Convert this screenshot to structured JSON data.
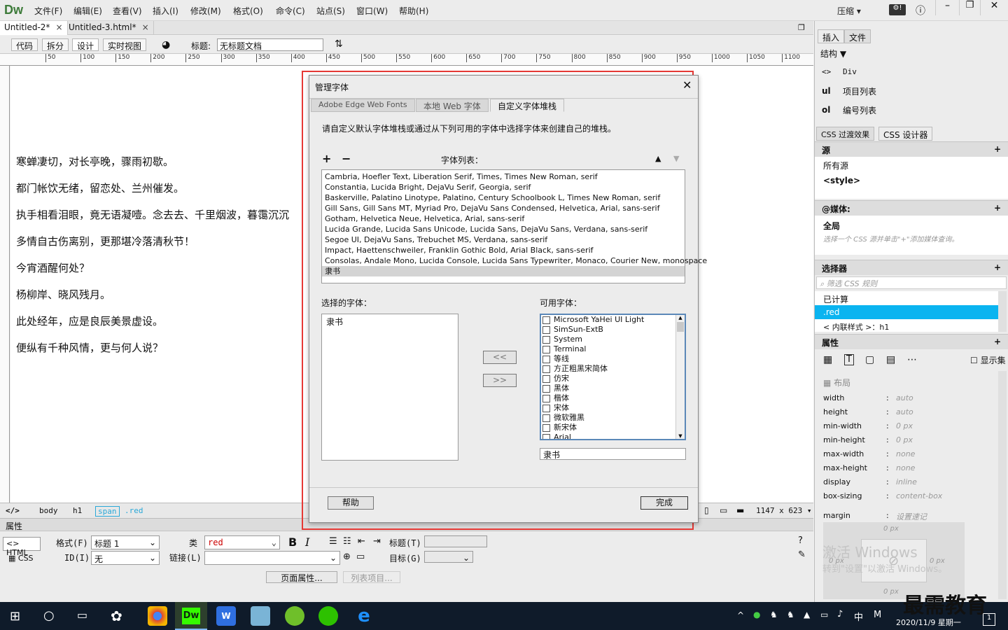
{
  "app": {
    "logo": "Dw",
    "compress_label": "压缩"
  },
  "menu": [
    "文件(F)",
    "编辑(E)",
    "查看(V)",
    "插入(I)",
    "修改(M)",
    "格式(O)",
    "命令(C)",
    "站点(S)",
    "窗口(W)",
    "帮助(H)"
  ],
  "doc_tabs": [
    {
      "label": "Untitled-2*"
    },
    {
      "label": "Untitled-3.html*"
    }
  ],
  "view_buttons": {
    "code": "代码",
    "split": "拆分",
    "design": "设计",
    "live": "实时视图"
  },
  "title_field": {
    "label": "标题:",
    "value": "无标题文档"
  },
  "ruler_ticks": [
    "50",
    "100",
    "150",
    "200",
    "250",
    "300",
    "350",
    "400",
    "450",
    "500",
    "550",
    "600",
    "650",
    "700",
    "750",
    "800",
    "850",
    "900",
    "950",
    "1000",
    "1050",
    "1100"
  ],
  "poem": [
    "寒蝉凄切，对长亭晚，骤雨初歇。",
    "都门帐饮无绪，留恋处、兰州催发。",
    "执手相看泪眼，竟无语凝噎。念去去、千里烟波，暮霭沉沉",
    "多情自古伤离别，更那堪冷落清秋节！",
    "今宵酒醒何处？",
    "杨柳岸、晓风残月。",
    "此处经年，应是良辰美景虚设。",
    "便纵有千种风情，更与何人说？"
  ],
  "status": {
    "tag_icon": "</>",
    "crumbs": [
      "body",
      "h1",
      "span",
      ".red"
    ],
    "size": "1147 x 623"
  },
  "properties": {
    "header": "属性",
    "html_btn": "HTML",
    "css_btn": "CSS",
    "format_label": "格式(F)",
    "format_value": "标题 1",
    "id_label": "ID(I)",
    "id_value": "无",
    "class_label": "类",
    "class_value": "red",
    "link_label": "链接(L)",
    "title_label": "标题(T)",
    "target_label": "目标(G)",
    "page_props_btn": "页面属性...",
    "list_item_btn": "列表项目..."
  },
  "right_panel": {
    "tabs": [
      "插入",
      "文件"
    ],
    "structure": "结构",
    "insert_items": [
      {
        "icon": "<>",
        "label": "Div"
      },
      {
        "icon": "ul",
        "label": "项目列表"
      },
      {
        "icon": "ol",
        "label": "编号列表"
      }
    ],
    "css_tabs": [
      "CSS 过渡效果",
      "CSS 设计器"
    ],
    "sources_header": "源",
    "sources": [
      "所有源",
      "<style>"
    ],
    "media_header": "@媒体:",
    "media_global": "全局",
    "media_hint": "选择一个 CSS 源并单击\"+\"添加媒体查询。",
    "selectors_header": "选择器",
    "selector_filter": "筛选 CSS 规则",
    "selectors": [
      "已计算",
      ".red",
      "< 内联样式 >：h1"
    ],
    "props_header": "属性",
    "show_set": "显示集",
    "layout_label": "布局",
    "layout_props": [
      {
        "name": "width",
        "value": "auto"
      },
      {
        "name": "height",
        "value": "auto"
      },
      {
        "name": "min-width",
        "value": "0 px"
      },
      {
        "name": "min-height",
        "value": "0 px"
      },
      {
        "name": "max-width",
        "value": "none"
      },
      {
        "name": "max-height",
        "value": "none"
      },
      {
        "name": "display",
        "value": "inline"
      },
      {
        "name": "box-sizing",
        "value": "content-box"
      }
    ],
    "margin": {
      "name": "margin",
      "value": "设置速记",
      "box_values": [
        "0 px",
        "0 px",
        "0 px",
        "0 px"
      ]
    }
  },
  "dialog": {
    "title": "管理字体",
    "tabs": [
      "Adobe Edge Web Fonts",
      "本地 Web 字体",
      "自定义字体堆栈"
    ],
    "instruction": "请自定义默认字体堆栈或通过从下列可用的字体中选择字体来创建自己的堆栈。",
    "font_list_label": "字体列表：",
    "font_list": [
      "Cambria, Hoefler Text, Liberation Serif, Times, Times New Roman, serif",
      "Constantia, Lucida Bright, DejaVu Serif, Georgia, serif",
      "Baskerville, Palatino Linotype, Palatino, Century Schoolbook L, Times New Roman, serif",
      "Gill Sans, Gill Sans MT, Myriad Pro, DejaVu Sans Condensed, Helvetica, Arial, sans-serif",
      "Gotham, Helvetica Neue, Helvetica, Arial, sans-serif",
      "Lucida Grande, Lucida Sans Unicode, Lucida Sans, DejaVu Sans, Verdana, sans-serif",
      "Segoe UI, DejaVu Sans, Trebuchet MS, Verdana, sans-serif",
      "Impact, Haettenschweiler, Franklin Gothic Bold, Arial Black, sans-serif",
      "Consolas, Andale Mono, Lucida Console, Lucida Sans Typewriter, Monaco, Courier New, monospace",
      "隶书"
    ],
    "selected_label": "选择的字体：",
    "selected_fonts": [
      "隶书"
    ],
    "available_label": "可用字体：",
    "available_fonts": [
      "Microsoft YaHei UI Light",
      "SimSun-ExtB",
      "System",
      "Terminal",
      "等线",
      "方正粗黑宋简体",
      "仿宋",
      "黑体",
      "楷体",
      "宋体",
      "微软雅黑",
      "新宋体",
      "Arial"
    ],
    "available_input": "隶书",
    "add_btn": "<<",
    "remove_btn": ">>",
    "help_btn": "帮助",
    "done_btn": "完成"
  },
  "watermark": {
    "line1": "激活 Windows",
    "line2": "转到\"设置\"以激活 Windows。"
  },
  "taskbar": {
    "ime": "中",
    "ime2": "M",
    "date": "2020/11/9 星期一",
    "brand": "最需教育"
  }
}
